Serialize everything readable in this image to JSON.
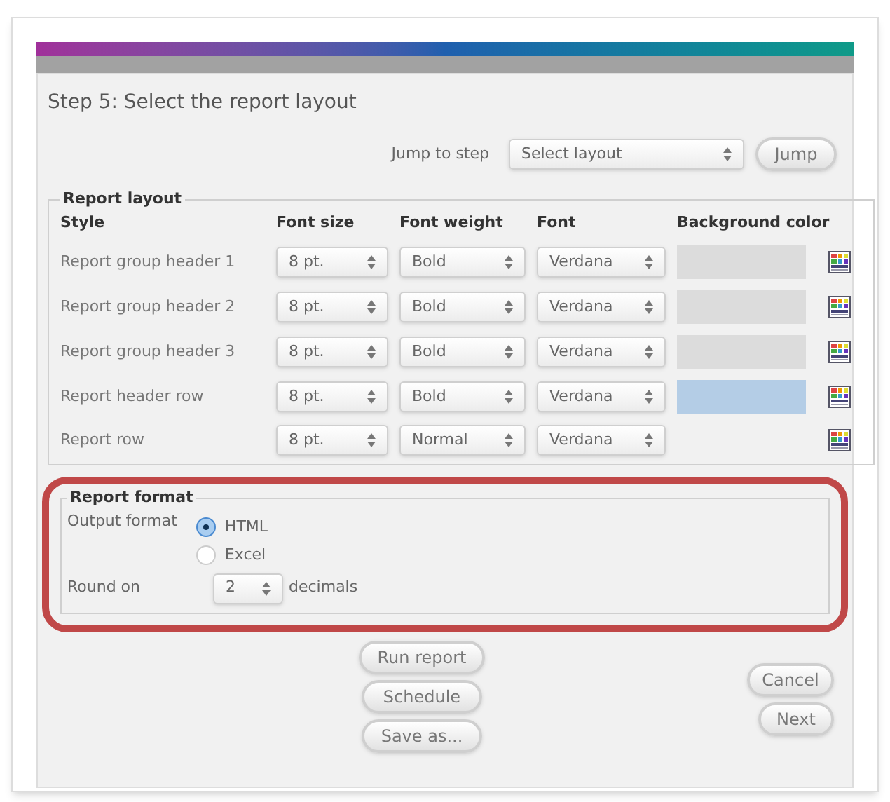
{
  "title": "Step 5: Select the report layout",
  "jump": {
    "label": "Jump to step",
    "value": "Select layout",
    "button": "Jump"
  },
  "report_layout": {
    "legend": "Report layout",
    "columns": [
      "Style",
      "Font size",
      "Font weight",
      "Font",
      "Background color"
    ],
    "rows": [
      {
        "style": "Report group header 1",
        "font_size": "8 pt.",
        "font_weight": "Bold",
        "font": "Verdana",
        "color": "#dcdcdc"
      },
      {
        "style": "Report group header 2",
        "font_size": "8 pt.",
        "font_weight": "Bold",
        "font": "Verdana",
        "color": "#dcdcdc"
      },
      {
        "style": "Report group header 3",
        "font_size": "8 pt.",
        "font_weight": "Bold",
        "font": "Verdana",
        "color": "#dcdcdc"
      },
      {
        "style": "Report header row",
        "font_size": "8 pt.",
        "font_weight": "Bold",
        "font": "Verdana",
        "color": "#b4cde6"
      },
      {
        "style": "Report row",
        "font_size": "8 pt.",
        "font_weight": "Normal",
        "font": "Verdana"
      }
    ]
  },
  "report_format": {
    "legend": "Report format",
    "output_label": "Output format",
    "options": [
      {
        "label": "HTML",
        "selected": true
      },
      {
        "label": "Excel",
        "selected": false
      }
    ],
    "round_label": "Round on",
    "round_value": "2",
    "round_suffix": "decimals"
  },
  "center_buttons": [
    "Run report",
    "Schedule",
    "Save as..."
  ],
  "right_buttons": [
    "Cancel",
    "Next"
  ]
}
